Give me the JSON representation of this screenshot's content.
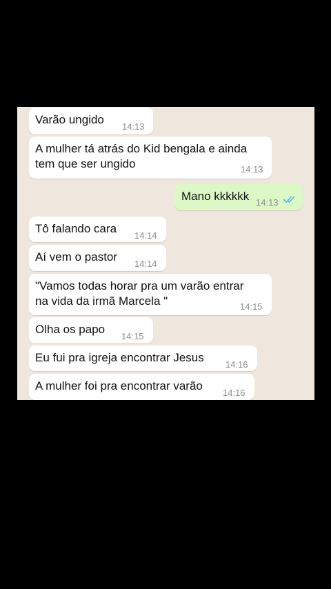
{
  "colors": {
    "chat_background": "#efe7de",
    "incoming_bubble": "#ffffff",
    "outgoing_bubble": "#dcf8c6",
    "read_tick": "#4fb6ec",
    "timestamp": "#8c8c8c"
  },
  "messages": [
    {
      "direction": "incoming",
      "text": "Varão ungido",
      "time": "14:13"
    },
    {
      "direction": "incoming",
      "text": "A mulher tá atrás do Kid bengala e ainda\ntem que ser ungido",
      "time": "14:13"
    },
    {
      "direction": "outgoing",
      "text": "Mano kkkkkk",
      "time": "14:13",
      "status_icon": "double-check-read-icon"
    },
    {
      "direction": "incoming",
      "text": "Tô falando cara",
      "time": "14:14"
    },
    {
      "direction": "incoming",
      "text": "Aí vem o pastor",
      "time": "14:14"
    },
    {
      "direction": "incoming",
      "text": "\"Vamos todas horar pra um varão entrar\nna vida da irmã Marcela \"",
      "time": "14:15"
    },
    {
      "direction": "incoming",
      "text": "Olha os papo",
      "time": "14:15"
    },
    {
      "direction": "incoming",
      "text": "Eu fui pra igreja encontrar Jesus",
      "time": "14:16"
    },
    {
      "direction": "incoming",
      "text": "A mulher foi pra encontrar varão",
      "time": "14:16"
    }
  ]
}
